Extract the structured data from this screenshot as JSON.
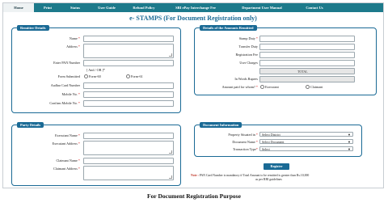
{
  "nav": {
    "items": [
      "Home",
      "Print",
      "Status",
      "User Guide",
      "Refund Policy",
      "SBI ePay Interchange Fee",
      "Department User Manual",
      "Contact Us"
    ],
    "active_index": 0
  },
  "page_title": "e- STAMPS (For Document Registration only)",
  "remitter": {
    "title": "Remitter Details",
    "name_label": "Name",
    "address_label": "Address",
    "pan_label": "Enter PAN Number",
    "and_or": "[ And / OR ]*",
    "form_submitted_label": "Form Submitted",
    "form60": "Form-60",
    "form61": "Form-61",
    "aadhar_label": "Aadhar Card Number",
    "mobile_label": "Mobile No.",
    "confirm_mobile_label": "Confirm Mobile No."
  },
  "amounts": {
    "title": "Details of the Amounts Remitted",
    "stamp_duty": "Stamp Duty",
    "transfer_duty": "Transfer Duty",
    "registration_fee": "Registration Fee",
    "user_charges": "User Charges",
    "total_label": "TOTAL",
    "in_words": "In Words Rupees",
    "paid_for_label": "Amount paid for whom?",
    "executant": "Executant",
    "claimant": "Claimant"
  },
  "party": {
    "title": "Party Details",
    "executant_name": "Executant Name",
    "executant_address": "Executant Address",
    "claimant_name": "Claimant Name",
    "claimant_address": "Claimant Address"
  },
  "document": {
    "title": "Document Information",
    "property_label": "Property Situated in",
    "property_value": "Select District",
    "doc_name_label": "Document Name",
    "doc_name_value": "Select Document",
    "transaction_label": "Transaction Type",
    "transaction_value": "Select"
  },
  "register_button": "Register",
  "note": {
    "prefix": "Note :",
    "text": "PAN Card Number is mandatory if Total Amount to be remitted is greater than Rs.10,000",
    "text2": "as per RBI guidelines"
  },
  "caption": "For Document Registration Purpose",
  "colors": {
    "nav": "#1d7a8b",
    "accent": "#1a6a95",
    "required": "#d22222"
  }
}
